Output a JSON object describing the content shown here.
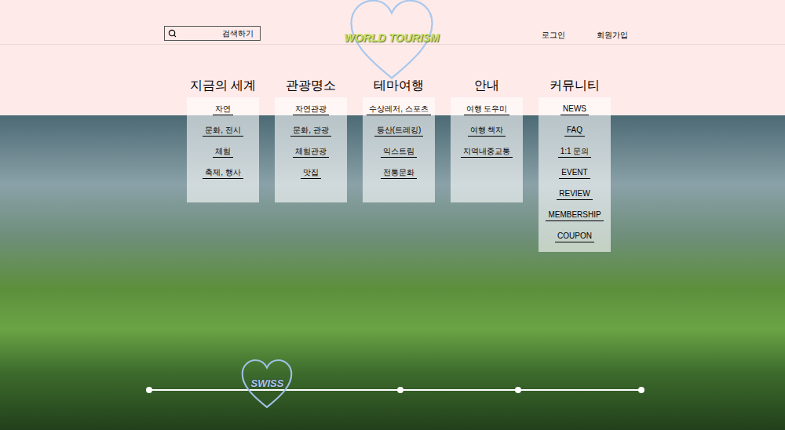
{
  "search": {
    "placeholder": "검색하기"
  },
  "logo": {
    "text": "WORLD TOURISM"
  },
  "auth_links": [
    "로그인",
    "회원가입"
  ],
  "menu": [
    {
      "title": "지금의 세계",
      "items": [
        "자연",
        "문화, 전시",
        "체험",
        "축제, 행사"
      ]
    },
    {
      "title": "관광명소",
      "items": [
        "자연관광",
        "문화, 관광",
        "체험관광",
        "맛집"
      ]
    },
    {
      "title": "테마여행",
      "items": [
        "수상레저, 스포츠",
        "등산(트레킹)",
        "익스트림",
        "전통문화"
      ]
    },
    {
      "title": "안내",
      "items": [
        "여행 도우미",
        "여행 책자",
        "지역내중교통"
      ]
    },
    {
      "title": "커뮤니티",
      "items": [
        "NEWS",
        "FAQ",
        "1:1 문의",
        "EVENT",
        "REVIEW",
        "MEMBERSHIP",
        "COUPON"
      ]
    }
  ],
  "slider": {
    "label": "SWISS",
    "level": 0.24,
    "stops": [
      0,
      0.51,
      0.75,
      1
    ]
  }
}
